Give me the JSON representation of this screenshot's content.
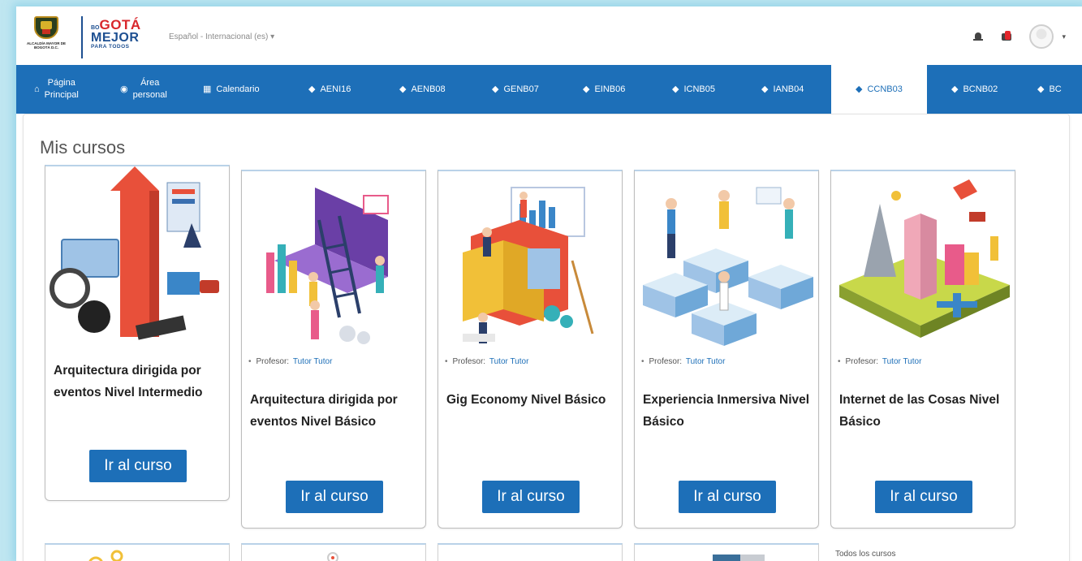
{
  "header": {
    "crest_text": "ALCALDÍA MAYOR DE BOGOTÁ D.C.",
    "brand_small": "BO",
    "brand_word": "GOTÁ",
    "brand_line2": "MEJOR",
    "brand_line3": "PARA TODOS",
    "language": "Español - Internacional (es)"
  },
  "nav": {
    "items": [
      {
        "icon": "home-icon",
        "label": "Página Principal",
        "line1": "Página",
        "line2": "Principal"
      },
      {
        "icon": "dashboard-icon",
        "label": "Área personal",
        "line1": "Área",
        "line2": "personal"
      },
      {
        "icon": "calendar-icon",
        "label": "Calendario"
      },
      {
        "icon": "graduation-cap-icon",
        "label": "AENI16"
      },
      {
        "icon": "graduation-cap-icon",
        "label": "AENB08"
      },
      {
        "icon": "graduation-cap-icon",
        "label": "GENB07"
      },
      {
        "icon": "graduation-cap-icon",
        "label": "EINB06"
      },
      {
        "icon": "graduation-cap-icon",
        "label": "ICNB05"
      },
      {
        "icon": "graduation-cap-icon",
        "label": "IANB04"
      },
      {
        "icon": "graduation-cap-icon",
        "label": "CCNB03",
        "active": true
      },
      {
        "icon": "graduation-cap-icon",
        "label": "BCNB02"
      },
      {
        "icon": "graduation-cap-icon",
        "label": "BC"
      }
    ]
  },
  "main": {
    "title": "Mis cursos",
    "button_label": "Ir al curso",
    "teacher_prefix": "Profesor:",
    "teacher_name": "Tutor Tutor",
    "courses": [
      {
        "title": "Arquitectura dirigida por eventos Nivel Intermedio"
      },
      {
        "title": "Arquitectura dirigida por eventos Nivel Básico"
      },
      {
        "title": "Gig Economy Nivel Básico"
      },
      {
        "title": "Experiencia Inmersiva Nivel Básico"
      },
      {
        "title": "Internet de las Cosas Nivel Básico"
      }
    ],
    "all_courses_link": "Todos los cursos"
  },
  "colors": {
    "nav_blue": "#1d6fb8",
    "brand_red": "#d8262b",
    "brand_blue": "#1d4f91",
    "badge_red": "#e3252a"
  }
}
